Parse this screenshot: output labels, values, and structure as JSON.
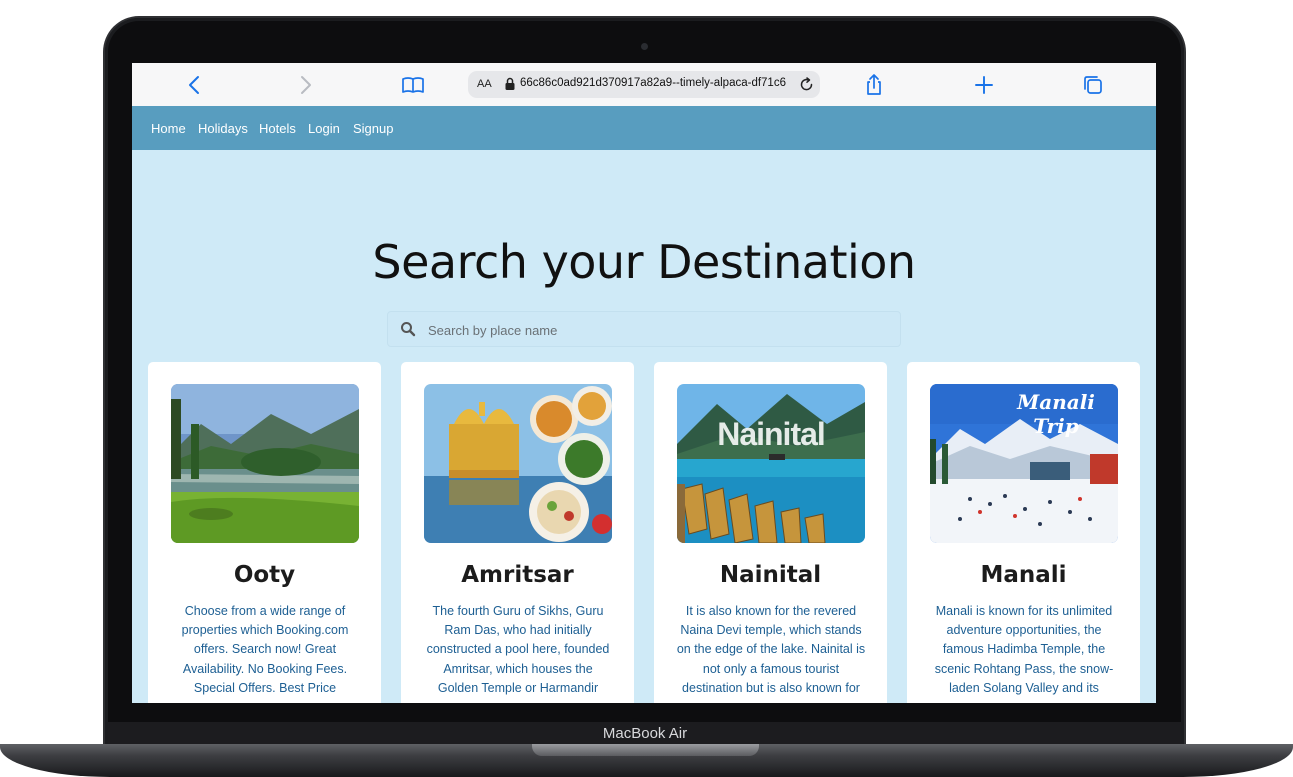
{
  "device": {
    "label": "MacBook Air"
  },
  "browser": {
    "text_size_label": "AA",
    "url": "66c86c0ad921d370917a82a9--timely-alpaca-df71c6"
  },
  "nav": {
    "links": [
      "Home",
      "Holidays",
      "Hotels",
      "Login",
      "Signup"
    ]
  },
  "main": {
    "heading": "Search your Destination",
    "search_placeholder": "Search by place name"
  },
  "cards": [
    {
      "title": "Ooty",
      "description": "Choose from a wide range of properties which Booking.com offers. Search now! Great Availability. No Booking Fees. Special Offers. Best Price"
    },
    {
      "title": "Amritsar",
      "description": "The fourth Guru of Sikhs, Guru Ram Das, who had initially constructed a pool here, founded Amritsar, which houses the Golden Temple or Harmandir"
    },
    {
      "title": "Nainital",
      "description": "It is also known for the revered Naina Devi temple, which stands on the edge of the lake. Nainital is not only a famous tourist destination but is also known for",
      "image_overlay_text": "Nainital"
    },
    {
      "title": "Manali",
      "description": "Manali is known for its unlimited adventure opportunities, the famous Hadimba Temple, the scenic Rohtang Pass, the snow-laden Solang Valley and its",
      "image_overlay_text": "Manali Trip"
    }
  ],
  "colors": {
    "navbar": "#589dbf",
    "page_background": "#cfeaf7",
    "description_text": "#1d5f93",
    "browser_accent": "#1a73e8"
  },
  "icons": [
    "back-icon",
    "forward-icon",
    "bookmarks-icon",
    "lock-icon",
    "reload-icon",
    "share-icon",
    "new-tab-icon",
    "tabs-icon",
    "search-icon"
  ]
}
